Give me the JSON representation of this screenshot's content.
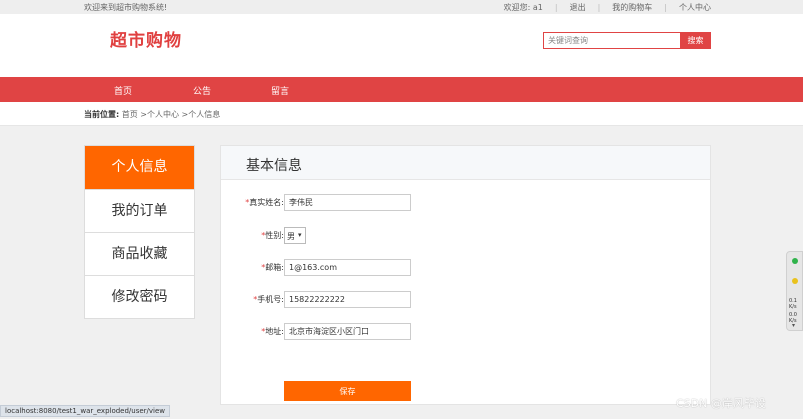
{
  "topbar": {
    "welcome": "欢迎来到超市购物系统!",
    "greeting": "欢迎您: a1",
    "logout": "退出",
    "cart": "我的购物车",
    "profile": "个人中心"
  },
  "header": {
    "logo": "超市购物",
    "search_placeholder": "关键词查询",
    "search_button": "搜索"
  },
  "nav": {
    "items": [
      "首页",
      "公告",
      "留言"
    ]
  },
  "breadcrumb": {
    "label": "当前位置:",
    "path": "首页 >个人中心 >个人信息"
  },
  "sidebar": {
    "items": [
      "个人信息",
      "我的订单",
      "商品收藏",
      "修改密码"
    ],
    "active": "个人信息"
  },
  "panel": {
    "title": "基本信息",
    "fields": {
      "name": {
        "label": "真实姓名:",
        "value": "李伟民"
      },
      "gender": {
        "label": "性别:",
        "value": "男"
      },
      "email": {
        "label": "邮箱:",
        "value": "1@163.com"
      },
      "phone": {
        "label": "手机号:",
        "value": "15822222222"
      },
      "address": {
        "label": "地址:",
        "value": "北京市海淀区小区门口"
      }
    },
    "required_mark": "*",
    "save_button": "保存"
  },
  "status_url": "localhost:8080/test1_war_exploded/user/view",
  "watermark": "CSDN @岸风毕设",
  "widget": {
    "value1": "0.1",
    "unit1": "K/s",
    "value2": "0.0",
    "unit2": "K/s"
  },
  "colors": {
    "brand_red": "#e04444",
    "accent_orange": "#ff6600",
    "widget_green": "#2fb24a",
    "widget_yellow": "#e9c21d"
  }
}
